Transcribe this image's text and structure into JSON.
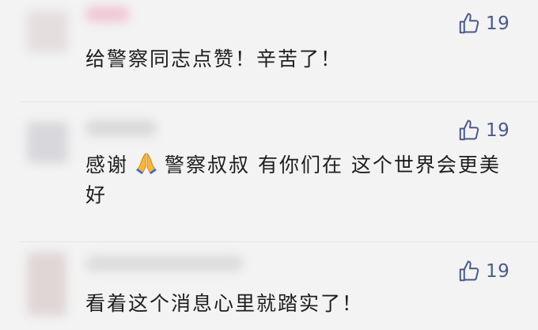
{
  "comments": [
    {
      "text": "给警察同志点赞！辛苦了！",
      "likes": "19"
    },
    {
      "text_before_emoji": "感谢",
      "emoji": "folded-hands-emoji",
      "text_after_emoji": "警察叔叔  有你们在  这个世界会更美好",
      "likes": "19"
    },
    {
      "text": "看着这个消息心里就踏实了！",
      "likes": "19"
    }
  ],
  "colors": {
    "background": "#f3f3f3",
    "like_icon": "#4a5a8a",
    "text": "#1e1e1e"
  }
}
